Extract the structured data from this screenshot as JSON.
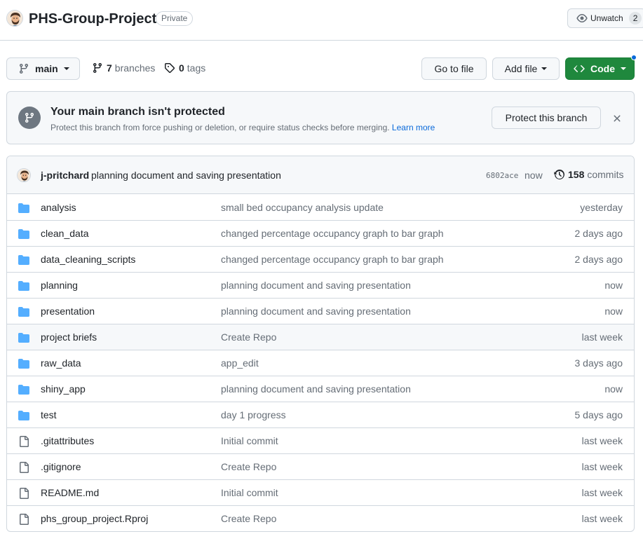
{
  "repo": {
    "name": "PHS-Group-Project",
    "visibility": "Private",
    "watch_label": "Unwatch",
    "watch_count": "2"
  },
  "toolbar": {
    "branch": "main",
    "branches_count": "7",
    "branches_label": "branches",
    "tags_count": "0",
    "tags_label": "tags",
    "goto_file": "Go to file",
    "add_file": "Add file",
    "code": "Code"
  },
  "protect": {
    "title": "Your main branch isn't protected",
    "description": "Protect this branch from force pushing or deletion, or require status checks before merging.",
    "learn_more": "Learn more",
    "button": "Protect this branch"
  },
  "commit": {
    "author": "j-pritchard",
    "message": "planning document and saving presentation",
    "sha": "6802ace",
    "age": "now",
    "count": "158",
    "count_label": "commits"
  },
  "files": [
    {
      "type": "dir",
      "name": "analysis",
      "message": "small bed occupancy analysis update",
      "age": "yesterday"
    },
    {
      "type": "dir",
      "name": "clean_data",
      "message": "changed percentage occupancy graph to bar graph",
      "age": "2 days ago"
    },
    {
      "type": "dir",
      "name": "data_cleaning_scripts",
      "message": "changed percentage occupancy graph to bar graph",
      "age": "2 days ago"
    },
    {
      "type": "dir",
      "name": "planning",
      "message": "planning document and saving presentation",
      "age": "now"
    },
    {
      "type": "dir",
      "name": "presentation",
      "message": "planning document and saving presentation",
      "age": "now"
    },
    {
      "type": "dir",
      "name": "project briefs",
      "message": "Create Repo",
      "age": "last week"
    },
    {
      "type": "dir",
      "name": "raw_data",
      "message": "app_edit",
      "age": "3 days ago"
    },
    {
      "type": "dir",
      "name": "shiny_app",
      "message": "planning document and saving presentation",
      "age": "now"
    },
    {
      "type": "dir",
      "name": "test",
      "message": "day 1 progress",
      "age": "5 days ago"
    },
    {
      "type": "file",
      "name": ".gitattributes",
      "message": "Initial commit",
      "age": "last week"
    },
    {
      "type": "file",
      "name": ".gitignore",
      "message": "Create Repo",
      "age": "last week"
    },
    {
      "type": "file",
      "name": "README.md",
      "message": "Initial commit",
      "age": "last week"
    },
    {
      "type": "file",
      "name": "phs_group_project.Rproj",
      "message": "Create Repo",
      "age": "last week"
    }
  ],
  "icons": {
    "dir": "folder-icon",
    "file": "file-icon"
  },
  "colors": {
    "accent": "#0969da",
    "folder": "#54aeff",
    "primary_button": "#1f883d"
  },
  "hovered_row": 5
}
